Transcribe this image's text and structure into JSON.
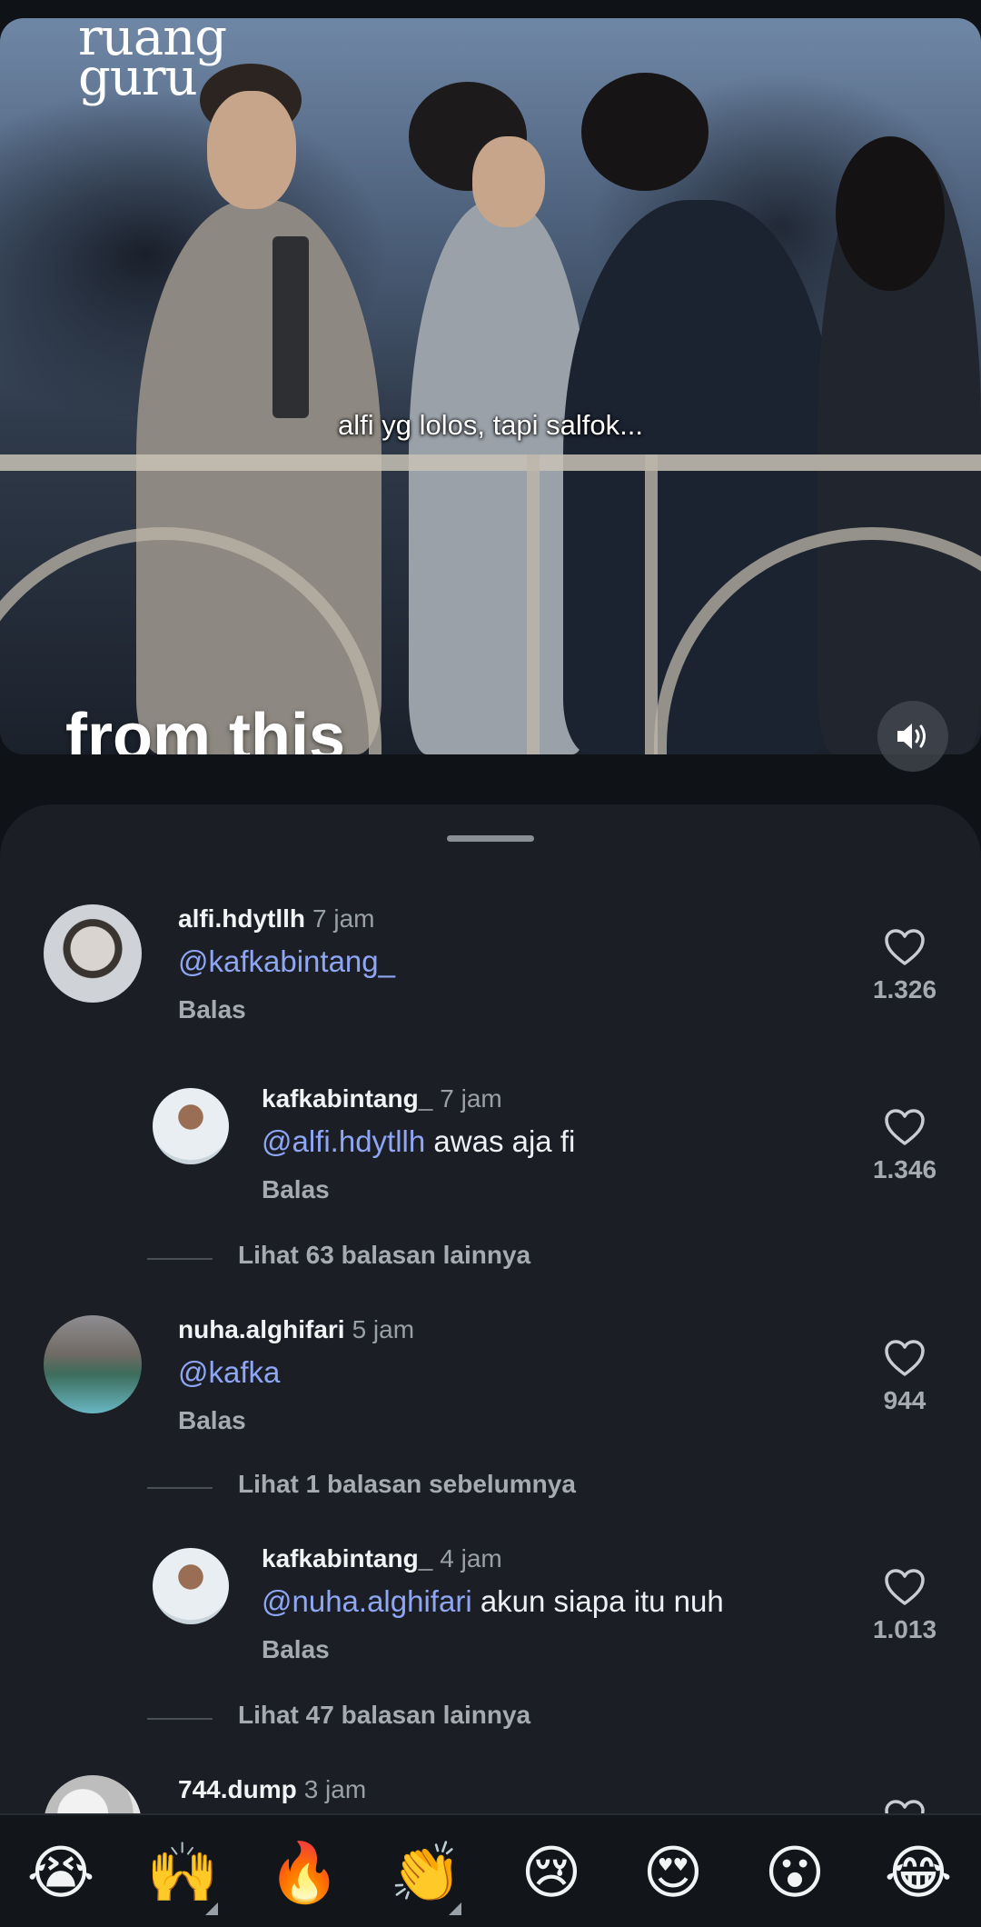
{
  "video": {
    "logo_line1": "ruang",
    "logo_line2": "guru",
    "subtitle": "alfi yg lolos, tapi salfok...",
    "caption": "from this",
    "mute_icon": "speaker-icon"
  },
  "comments": [
    {
      "username": "alfi.hdytllh",
      "time": "7 jam",
      "mention": "@kafkabintang_",
      "text": "",
      "reply_label": "Balas",
      "likes": "1.326"
    },
    {
      "username": "kafkabintang_",
      "time": "7 jam",
      "mention": "@alfi.hdytllh",
      "text": " awas aja fi",
      "reply_label": "Balas",
      "likes": "1.346"
    },
    {
      "username": "nuha.alghifari",
      "time": "5 jam",
      "mention": "@kafka",
      "text": "",
      "reply_label": "Balas",
      "likes": "944"
    },
    {
      "username": "kafkabintang_",
      "time": "4 jam",
      "mention": "@nuha.alghifari",
      "text": " akun siapa itu nuh",
      "reply_label": "Balas",
      "likes": "1.013"
    },
    {
      "username": "744.dump",
      "time": "3 jam"
    }
  ],
  "view_more": {
    "first": "Lihat 63 balasan lainnya",
    "previous": "Lihat 1 balasan sebelumnya",
    "second": "Lihat 47 balasan lainnya"
  },
  "emoji_bar": [
    "😭",
    "🙌",
    "🔥",
    "👏",
    "😢",
    "😍",
    "😮",
    "😂"
  ],
  "colors": {
    "sheet_bg": "#1b1f25",
    "mention": "#8fa6f5",
    "muted_text": "#a6abb3"
  }
}
